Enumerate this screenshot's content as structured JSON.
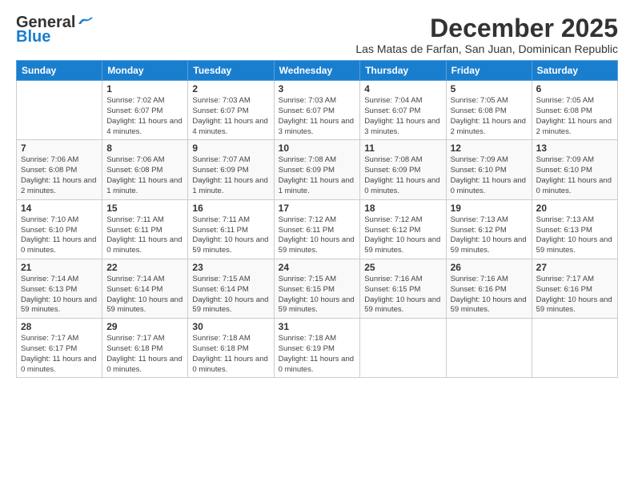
{
  "header": {
    "logo_line1": "General",
    "logo_line2": "Blue",
    "month": "December 2025",
    "location": "Las Matas de Farfan, San Juan, Dominican Republic"
  },
  "weekdays": [
    "Sunday",
    "Monday",
    "Tuesday",
    "Wednesday",
    "Thursday",
    "Friday",
    "Saturday"
  ],
  "weeks": [
    [
      {
        "day": "",
        "sunrise": "",
        "sunset": "",
        "daylight": ""
      },
      {
        "day": "1",
        "sunrise": "Sunrise: 7:02 AM",
        "sunset": "Sunset: 6:07 PM",
        "daylight": "Daylight: 11 hours and 4 minutes."
      },
      {
        "day": "2",
        "sunrise": "Sunrise: 7:03 AM",
        "sunset": "Sunset: 6:07 PM",
        "daylight": "Daylight: 11 hours and 4 minutes."
      },
      {
        "day": "3",
        "sunrise": "Sunrise: 7:03 AM",
        "sunset": "Sunset: 6:07 PM",
        "daylight": "Daylight: 11 hours and 3 minutes."
      },
      {
        "day": "4",
        "sunrise": "Sunrise: 7:04 AM",
        "sunset": "Sunset: 6:07 PM",
        "daylight": "Daylight: 11 hours and 3 minutes."
      },
      {
        "day": "5",
        "sunrise": "Sunrise: 7:05 AM",
        "sunset": "Sunset: 6:08 PM",
        "daylight": "Daylight: 11 hours and 2 minutes."
      },
      {
        "day": "6",
        "sunrise": "Sunrise: 7:05 AM",
        "sunset": "Sunset: 6:08 PM",
        "daylight": "Daylight: 11 hours and 2 minutes."
      }
    ],
    [
      {
        "day": "7",
        "sunrise": "Sunrise: 7:06 AM",
        "sunset": "Sunset: 6:08 PM",
        "daylight": "Daylight: 11 hours and 2 minutes."
      },
      {
        "day": "8",
        "sunrise": "Sunrise: 7:06 AM",
        "sunset": "Sunset: 6:08 PM",
        "daylight": "Daylight: 11 hours and 1 minute."
      },
      {
        "day": "9",
        "sunrise": "Sunrise: 7:07 AM",
        "sunset": "Sunset: 6:09 PM",
        "daylight": "Daylight: 11 hours and 1 minute."
      },
      {
        "day": "10",
        "sunrise": "Sunrise: 7:08 AM",
        "sunset": "Sunset: 6:09 PM",
        "daylight": "Daylight: 11 hours and 1 minute."
      },
      {
        "day": "11",
        "sunrise": "Sunrise: 7:08 AM",
        "sunset": "Sunset: 6:09 PM",
        "daylight": "Daylight: 11 hours and 0 minutes."
      },
      {
        "day": "12",
        "sunrise": "Sunrise: 7:09 AM",
        "sunset": "Sunset: 6:10 PM",
        "daylight": "Daylight: 11 hours and 0 minutes."
      },
      {
        "day": "13",
        "sunrise": "Sunrise: 7:09 AM",
        "sunset": "Sunset: 6:10 PM",
        "daylight": "Daylight: 11 hours and 0 minutes."
      }
    ],
    [
      {
        "day": "14",
        "sunrise": "Sunrise: 7:10 AM",
        "sunset": "Sunset: 6:10 PM",
        "daylight": "Daylight: 11 hours and 0 minutes."
      },
      {
        "day": "15",
        "sunrise": "Sunrise: 7:11 AM",
        "sunset": "Sunset: 6:11 PM",
        "daylight": "Daylight: 11 hours and 0 minutes."
      },
      {
        "day": "16",
        "sunrise": "Sunrise: 7:11 AM",
        "sunset": "Sunset: 6:11 PM",
        "daylight": "Daylight: 10 hours and 59 minutes."
      },
      {
        "day": "17",
        "sunrise": "Sunrise: 7:12 AM",
        "sunset": "Sunset: 6:11 PM",
        "daylight": "Daylight: 10 hours and 59 minutes."
      },
      {
        "day": "18",
        "sunrise": "Sunrise: 7:12 AM",
        "sunset": "Sunset: 6:12 PM",
        "daylight": "Daylight: 10 hours and 59 minutes."
      },
      {
        "day": "19",
        "sunrise": "Sunrise: 7:13 AM",
        "sunset": "Sunset: 6:12 PM",
        "daylight": "Daylight: 10 hours and 59 minutes."
      },
      {
        "day": "20",
        "sunrise": "Sunrise: 7:13 AM",
        "sunset": "Sunset: 6:13 PM",
        "daylight": "Daylight: 10 hours and 59 minutes."
      }
    ],
    [
      {
        "day": "21",
        "sunrise": "Sunrise: 7:14 AM",
        "sunset": "Sunset: 6:13 PM",
        "daylight": "Daylight: 10 hours and 59 minutes."
      },
      {
        "day": "22",
        "sunrise": "Sunrise: 7:14 AM",
        "sunset": "Sunset: 6:14 PM",
        "daylight": "Daylight: 10 hours and 59 minutes."
      },
      {
        "day": "23",
        "sunrise": "Sunrise: 7:15 AM",
        "sunset": "Sunset: 6:14 PM",
        "daylight": "Daylight: 10 hours and 59 minutes."
      },
      {
        "day": "24",
        "sunrise": "Sunrise: 7:15 AM",
        "sunset": "Sunset: 6:15 PM",
        "daylight": "Daylight: 10 hours and 59 minutes."
      },
      {
        "day": "25",
        "sunrise": "Sunrise: 7:16 AM",
        "sunset": "Sunset: 6:15 PM",
        "daylight": "Daylight: 10 hours and 59 minutes."
      },
      {
        "day": "26",
        "sunrise": "Sunrise: 7:16 AM",
        "sunset": "Sunset: 6:16 PM",
        "daylight": "Daylight: 10 hours and 59 minutes."
      },
      {
        "day": "27",
        "sunrise": "Sunrise: 7:17 AM",
        "sunset": "Sunset: 6:16 PM",
        "daylight": "Daylight: 10 hours and 59 minutes."
      }
    ],
    [
      {
        "day": "28",
        "sunrise": "Sunrise: 7:17 AM",
        "sunset": "Sunset: 6:17 PM",
        "daylight": "Daylight: 11 hours and 0 minutes."
      },
      {
        "day": "29",
        "sunrise": "Sunrise: 7:17 AM",
        "sunset": "Sunset: 6:18 PM",
        "daylight": "Daylight: 11 hours and 0 minutes."
      },
      {
        "day": "30",
        "sunrise": "Sunrise: 7:18 AM",
        "sunset": "Sunset: 6:18 PM",
        "daylight": "Daylight: 11 hours and 0 minutes."
      },
      {
        "day": "31",
        "sunrise": "Sunrise: 7:18 AM",
        "sunset": "Sunset: 6:19 PM",
        "daylight": "Daylight: 11 hours and 0 minutes."
      },
      {
        "day": "",
        "sunrise": "",
        "sunset": "",
        "daylight": ""
      },
      {
        "day": "",
        "sunrise": "",
        "sunset": "",
        "daylight": ""
      },
      {
        "day": "",
        "sunrise": "",
        "sunset": "",
        "daylight": ""
      }
    ]
  ]
}
